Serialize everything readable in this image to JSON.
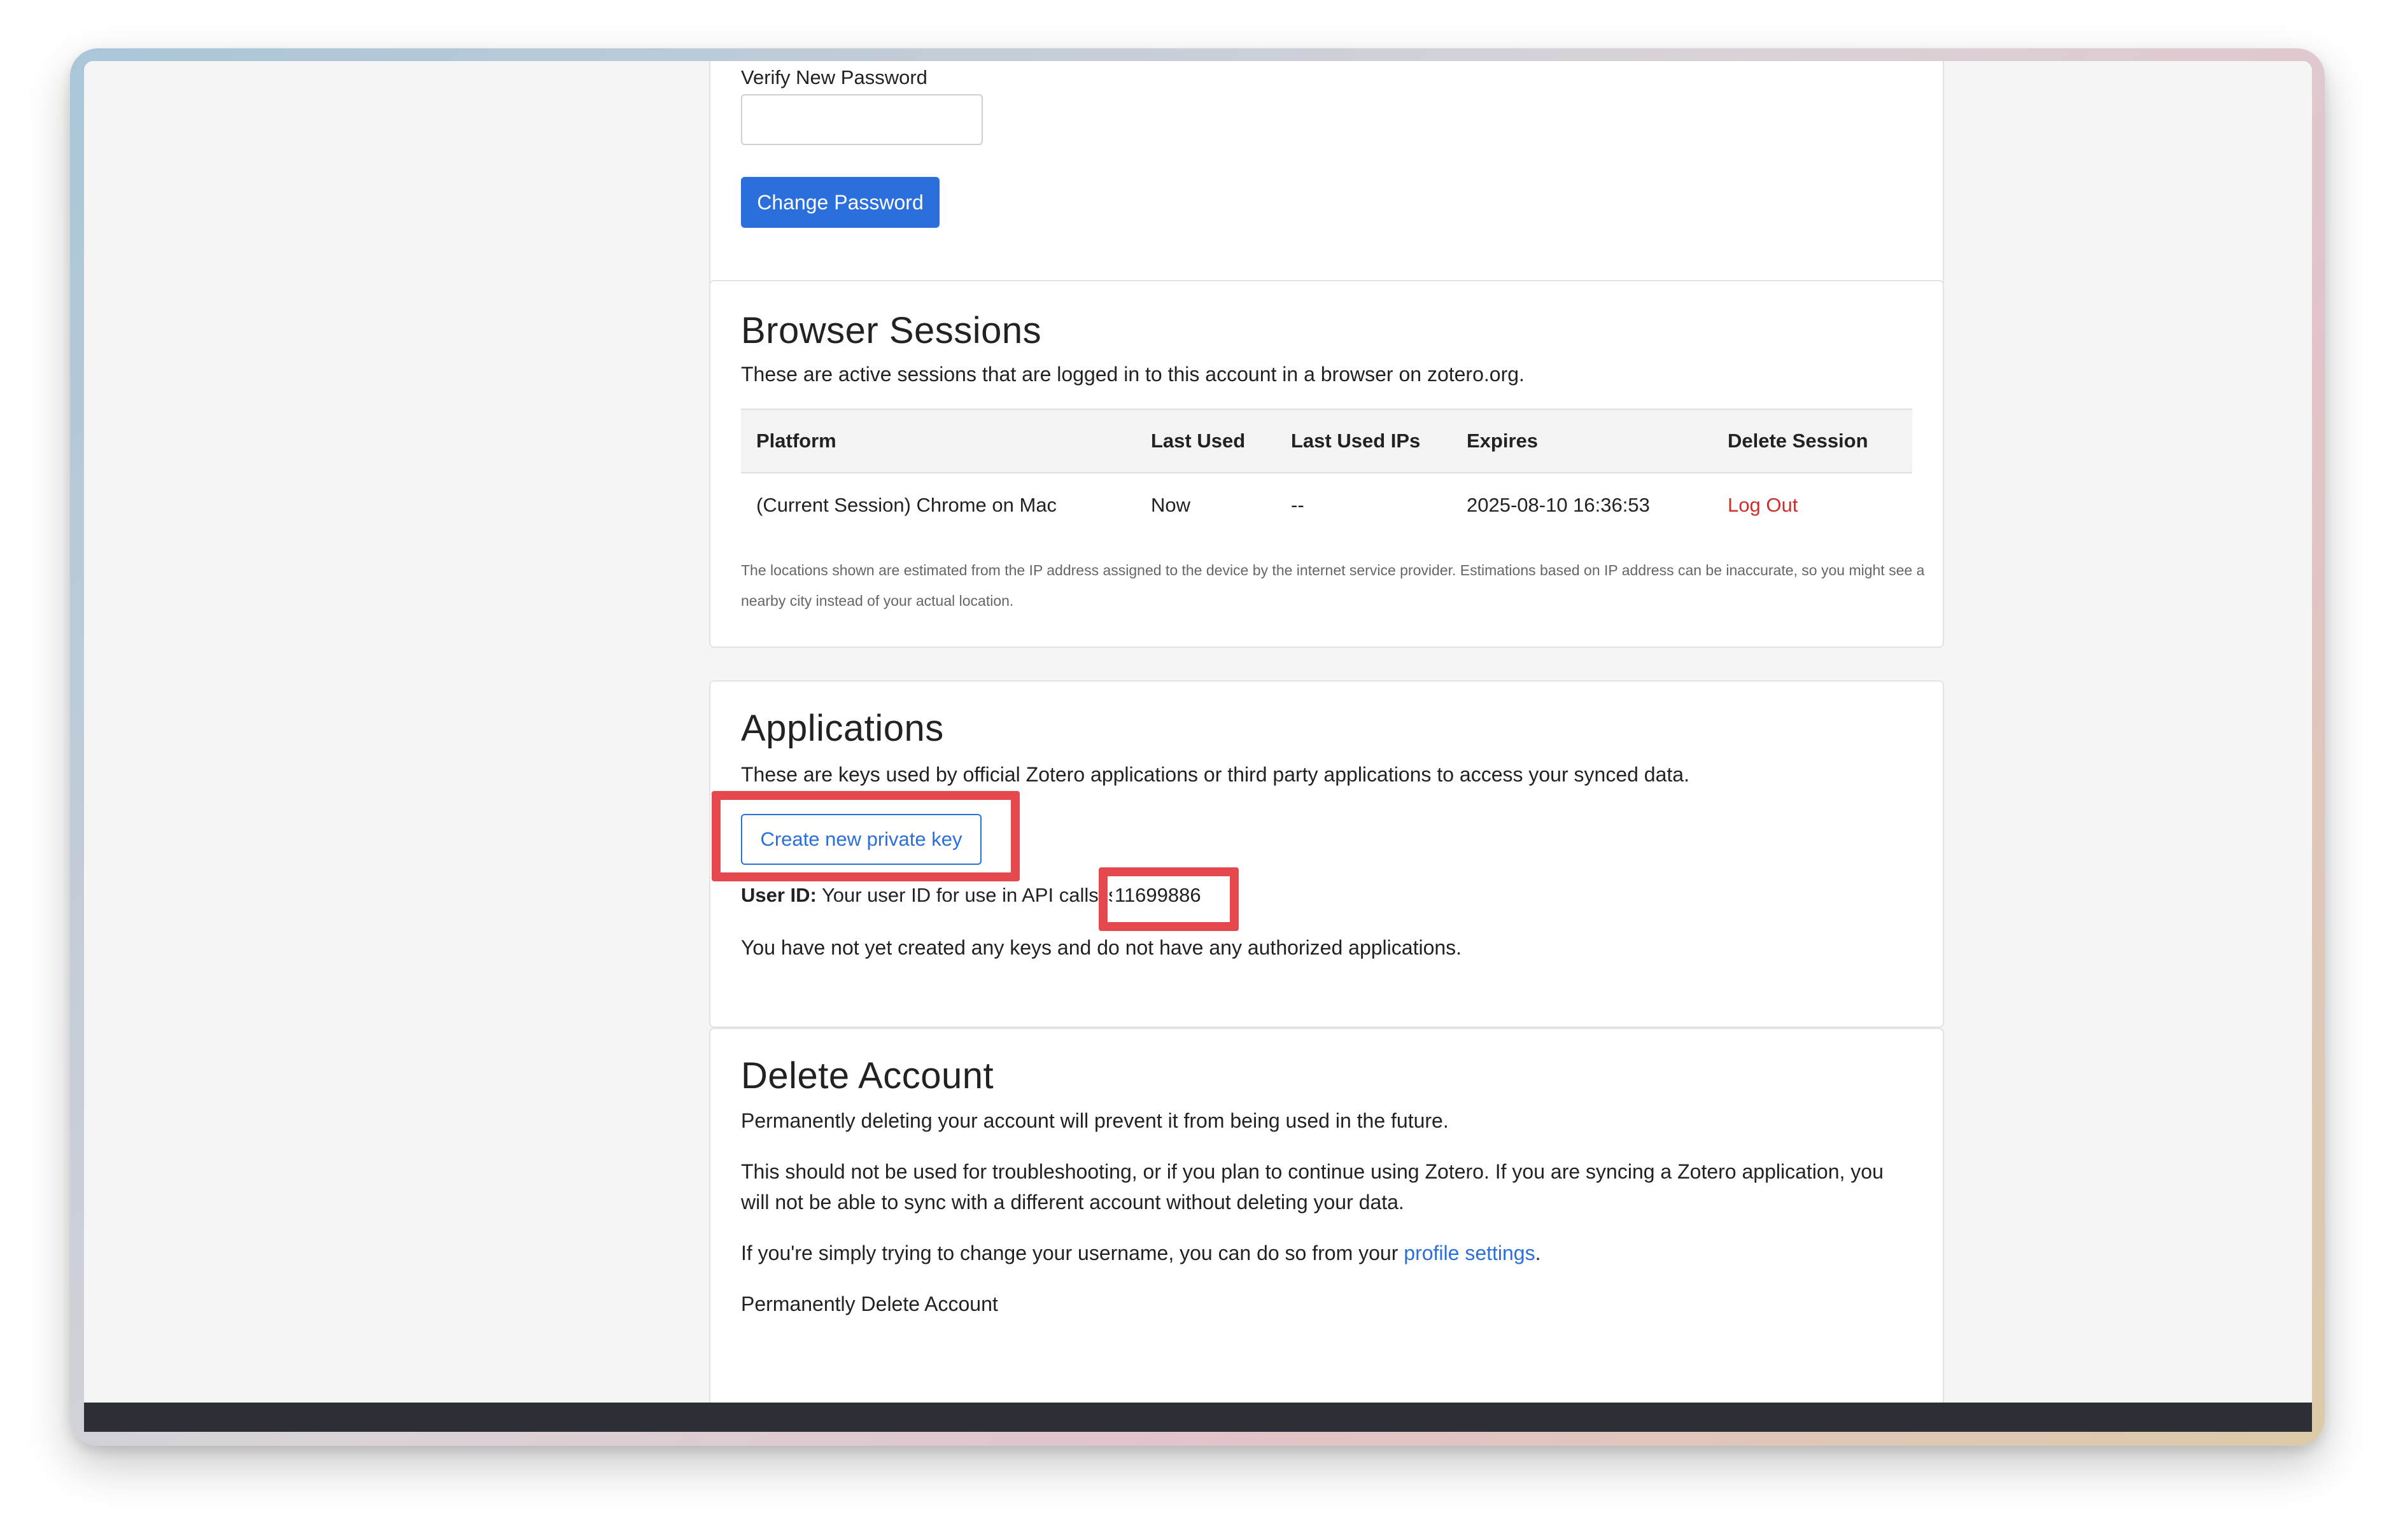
{
  "password": {
    "verify_label": "Verify New Password",
    "verify_value": "",
    "change_button": "Change Password"
  },
  "sessions": {
    "title": "Browser Sessions",
    "description": "These are active sessions that are logged in to this account in a browser on zotero.org.",
    "columns": [
      "Platform",
      "Last Used",
      "Last Used IPs",
      "Expires",
      "Delete Session"
    ],
    "rows": [
      {
        "platform": "(Current Session) Chrome on Mac",
        "last_used": "Now",
        "ips": "--",
        "expires": "2025-08-10 16:36:53",
        "action": "Log Out"
      }
    ],
    "note": "The locations shown are estimated from the IP address assigned to the device by the internet service provider. Estimations based on IP address can be inaccurate, so you might see a nearby city instead of your actual location."
  },
  "applications": {
    "title": "Applications",
    "description": "These are keys used by official Zotero applications or third party applications to access your synced data.",
    "create_key_button": "Create new private key",
    "user_id_label": "User ID:",
    "user_id_text": "Your user ID for use in API calls is",
    "user_id_value": "11699886",
    "no_keys_text": "You have not yet created any keys and do not have any authorized applications."
  },
  "delete_account": {
    "title": "Delete Account",
    "p1": "Permanently deleting your account will prevent it from being used in the future.",
    "p2": "This should not be used for troubleshooting, or if you plan to continue using Zotero. If you are syncing a Zotero application, you will not be able to sync with a different account without deleting your data.",
    "p3_prefix": "If you're simply trying to change your username, you can do so from your",
    "p3_link": "profile settings",
    "p3_suffix": ".",
    "delete_link": "Permanently Delete Account"
  },
  "colors": {
    "primary": "#2a6fdb",
    "danger": "#c9302c",
    "highlight": "#e5484d"
  }
}
